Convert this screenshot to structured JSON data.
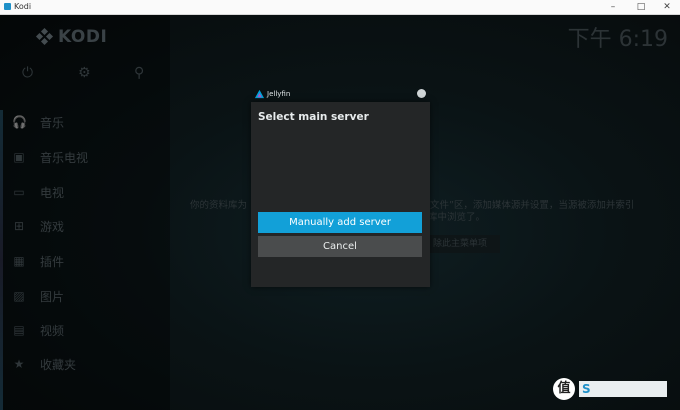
{
  "os_window": {
    "title": "Kodi",
    "minimize_glyph": "–",
    "maximize_glyph": "□",
    "close_glyph": "✕"
  },
  "kodi": {
    "logo_text": "KODI",
    "clock": "下午 6:19",
    "top_icons": [
      {
        "icon": "power-icon",
        "glyph": "⏻"
      },
      {
        "icon": "gear-icon",
        "glyph": "⚙"
      },
      {
        "icon": "search-icon",
        "glyph": "⚲"
      }
    ],
    "menu": [
      {
        "label": "音乐",
        "icon": "headphones-icon",
        "glyph": "🎧"
      },
      {
        "label": "音乐电视",
        "icon": "music-video-icon",
        "glyph": "▣"
      },
      {
        "label": "电视",
        "icon": "tv-icon",
        "glyph": "▭"
      },
      {
        "label": "游戏",
        "icon": "gamepad-icon",
        "glyph": "⊞"
      },
      {
        "label": "插件",
        "icon": "addon-box-icon",
        "glyph": "▦"
      },
      {
        "label": "图片",
        "icon": "picture-icon",
        "glyph": "▨"
      },
      {
        "label": "视频",
        "icon": "video-icon",
        "glyph": "▤"
      },
      {
        "label": "收藏夹",
        "icon": "star-icon",
        "glyph": "★"
      }
    ],
    "background_text": {
      "line1_left": "你的资料库为",
      "line1_right": "文件”区，添加媒体源并设置，当源被添加并索引",
      "line2": "库中浏览了。",
      "button": "除此主菜单项"
    }
  },
  "dialog": {
    "header_label": "Jellyfin",
    "title": "Select main server",
    "buttons": {
      "manual_add": "Manually add server",
      "cancel": "Cancel"
    }
  },
  "watermark": {
    "badge": "值",
    "text": "S"
  }
}
